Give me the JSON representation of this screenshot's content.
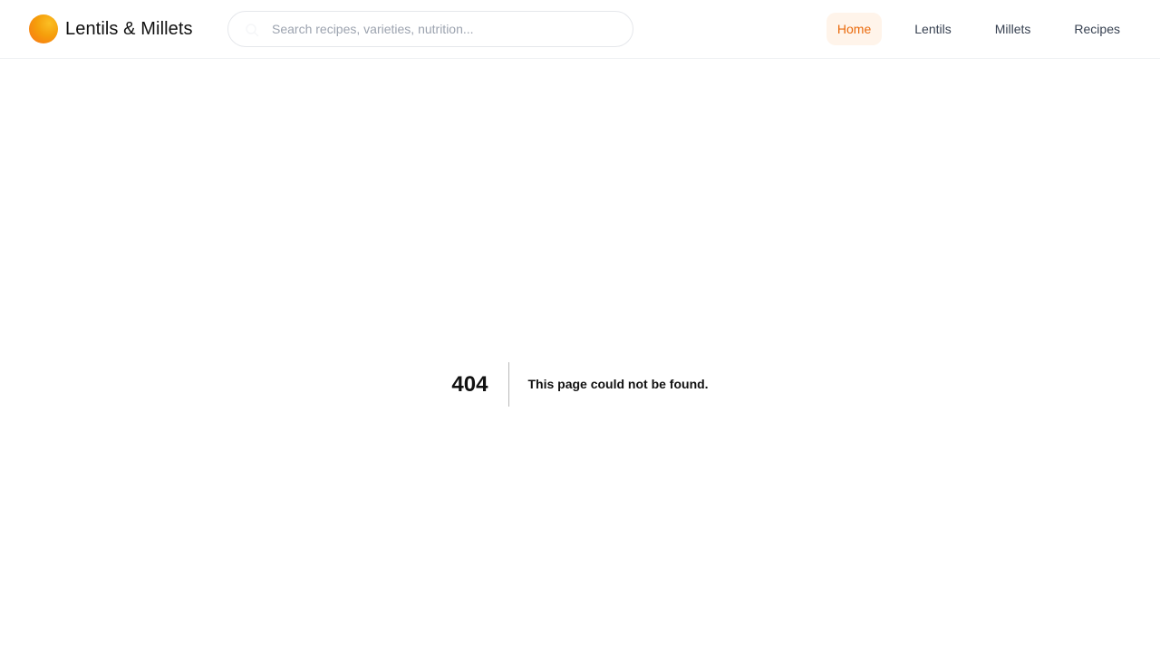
{
  "header": {
    "brand": "Lentils & Millets",
    "search": {
      "placeholder": "Search recipes, varieties, nutrition...",
      "value": "",
      "icon": "search-icon"
    },
    "nav": [
      {
        "label": "Home",
        "active": true
      },
      {
        "label": "Lentils",
        "active": false
      },
      {
        "label": "Millets",
        "active": false
      },
      {
        "label": "Recipes",
        "active": false
      }
    ]
  },
  "error": {
    "code": "404",
    "message": "This page could not be found."
  },
  "colors": {
    "accent": "#ea6a0c",
    "accent_bg": "#fff4ea",
    "logo_gradient": [
      "#fbbf24",
      "#f59e0b",
      "#f97316"
    ]
  }
}
